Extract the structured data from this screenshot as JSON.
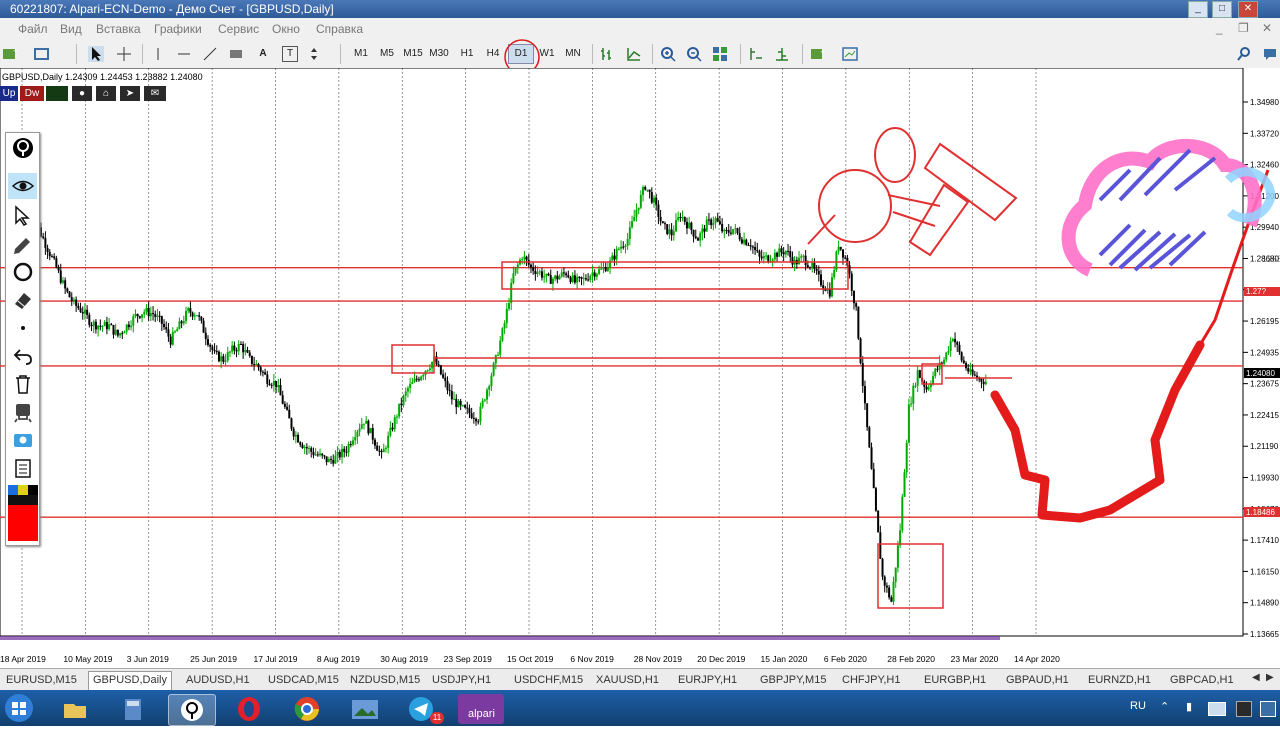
{
  "window": {
    "title": "60221807: Alpari-ECN-Demo - Демо Счет - [GBPUSD,Daily]"
  },
  "menu": [
    "Файл",
    "Вид",
    "Вставка",
    "Графики",
    "Сервис",
    "Окно",
    "Справка"
  ],
  "timeframes": [
    "M1",
    "M5",
    "M15",
    "M30",
    "H1",
    "H4",
    "D1",
    "W1",
    "MN"
  ],
  "active_timeframe": "D1",
  "chart": {
    "info": "GBPUSD,Daily  1.24309 1.24453 1.23882 1.24080",
    "buttons": {
      "up": "Up",
      "dw": "Dw"
    },
    "current_price": "1.24080",
    "line_price_1": "1.27?",
    "line_price_2": "1.18486",
    "watermark": "1268"
  },
  "chart_data": {
    "type": "candlestick",
    "symbol": "GBPUSD",
    "timeframe": "Daily",
    "price_ticks": [
      "1.34980",
      "1.33720",
      "1.32460",
      "1.31200",
      "1.29940",
      "1.28680",
      "1.27420",
      "1.26195",
      "1.24935",
      "1.23675",
      "1.22415",
      "1.21190",
      "1.19930",
      "1.18670",
      "1.17410",
      "1.16150",
      "1.14890",
      "1.13665"
    ],
    "date_ticks": [
      "18 Apr 2019",
      "10 May 2019",
      "3 Jun 2019",
      "25 Jun 2019",
      "17 Jul 2019",
      "8 Aug 2019",
      "30 Aug 2019",
      "23 Sep 2019",
      "15 Oct 2019",
      "6 Nov 2019",
      "28 Nov 2019",
      "20 Dec 2019",
      "15 Jan 2020",
      "6 Feb 2020",
      "28 Feb 2020",
      "23 Mar 2020",
      "14 Apr 2020"
    ],
    "ylim": [
      1.1366,
      1.3565
    ],
    "close_path": [
      1.315,
      1.304,
      1.296,
      1.288,
      1.279,
      1.273,
      1.27,
      1.265,
      1.264,
      1.264,
      1.26,
      1.264,
      1.268,
      1.27,
      1.269,
      1.265,
      1.258,
      1.264,
      1.27,
      1.269,
      1.26,
      1.252,
      1.25,
      1.254,
      1.256,
      1.25,
      1.247,
      1.242,
      1.24,
      1.23,
      1.22,
      1.215,
      1.212,
      1.21,
      1.208,
      1.21,
      1.213,
      1.22,
      1.225,
      1.218,
      1.21,
      1.22,
      1.23,
      1.238,
      1.242,
      1.246,
      1.25,
      1.242,
      1.234,
      1.23,
      1.228,
      1.226,
      1.238,
      1.25,
      1.265,
      1.285,
      1.293,
      1.288,
      1.286,
      1.283,
      1.284,
      1.286,
      1.282,
      1.283,
      1.286,
      1.287,
      1.29,
      1.296,
      1.3,
      1.312,
      1.322,
      1.315,
      1.305,
      1.302,
      1.31,
      1.305,
      1.3,
      1.306,
      1.308,
      1.302,
      1.304,
      1.3,
      1.298,
      1.292,
      1.292,
      1.294,
      1.295,
      1.29,
      1.292,
      1.288,
      1.282,
      1.278,
      1.298,
      1.29,
      1.27,
      1.23,
      1.195,
      1.16,
      1.15,
      1.18,
      1.23,
      1.245,
      1.238,
      1.245,
      1.25,
      1.26,
      1.25,
      1.244,
      1.242,
      1.2408
    ],
    "horizontal_lines": [
      1.288,
      1.2742,
      1.2474,
      1.1849
    ]
  },
  "panel_tools": [
    "logo-icon",
    "eye-icon",
    "cursor-icon",
    "pencil-icon",
    "circle-icon",
    "eraser-icon",
    "dot-icon",
    "undo-icon",
    "trash-icon",
    "stamp-icon",
    "screenshot-icon",
    "clipboard-icon",
    "palette-icon"
  ],
  "tabs": [
    "EURUSD,M15",
    "GBPUSD,Daily",
    "AUDUSD,H1",
    "USDCAD,M15",
    "NZDUSD,M15",
    "USDJPY,H1",
    "USDCHF,M15",
    "XAUUSD,H1",
    "EURJPY,H1",
    "GBPJPY,M15",
    "CHFJPY,H1",
    "EURGBP,H1",
    "GBPAUD,H1",
    "EURNZD,H1",
    "GBPCAD,H1"
  ],
  "active_tab": "GBPUSD,Daily",
  "taskbar": {
    "alpari_label": "alpari",
    "badge": "11",
    "lang": "RU"
  },
  "colors": {
    "bull": "#00aa00",
    "bear": "#000000",
    "level_line": "#e03030",
    "accent": "#d81b1b"
  }
}
